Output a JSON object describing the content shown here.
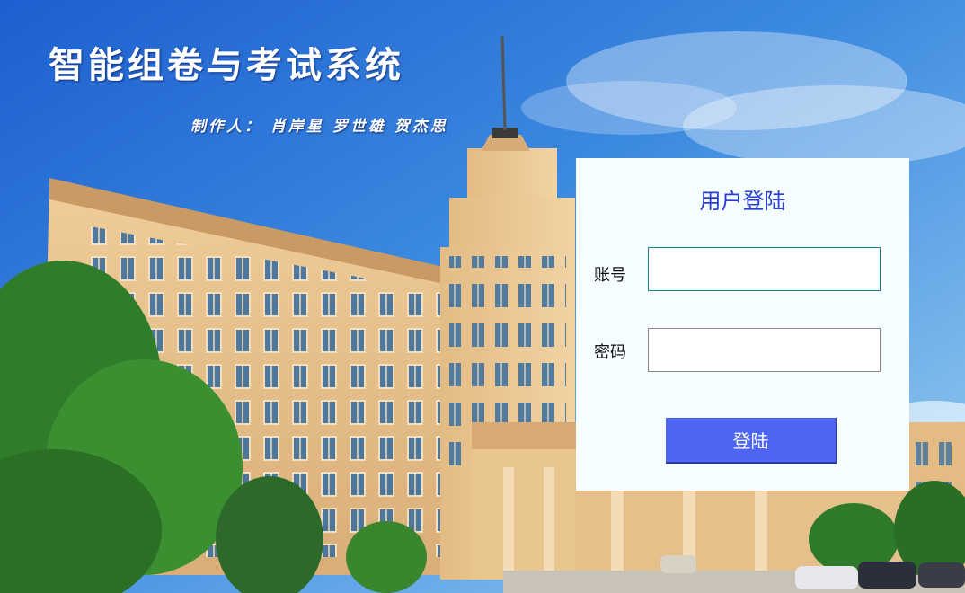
{
  "header": {
    "title": "智能组卷与考试系统",
    "credits": "制作人： 肖岸星 罗世雄 贺杰思"
  },
  "login": {
    "title": "用户登陆",
    "account_label": "账号",
    "account_value": "",
    "password_label": "密码",
    "password_value": "",
    "submit_label": "登陆"
  },
  "colors": {
    "sky": "#2f79d8",
    "panel_bg": "#f5fdff",
    "title_blue": "#2a3fd0",
    "button": "#4f66f4",
    "building": "#e7c08a"
  }
}
